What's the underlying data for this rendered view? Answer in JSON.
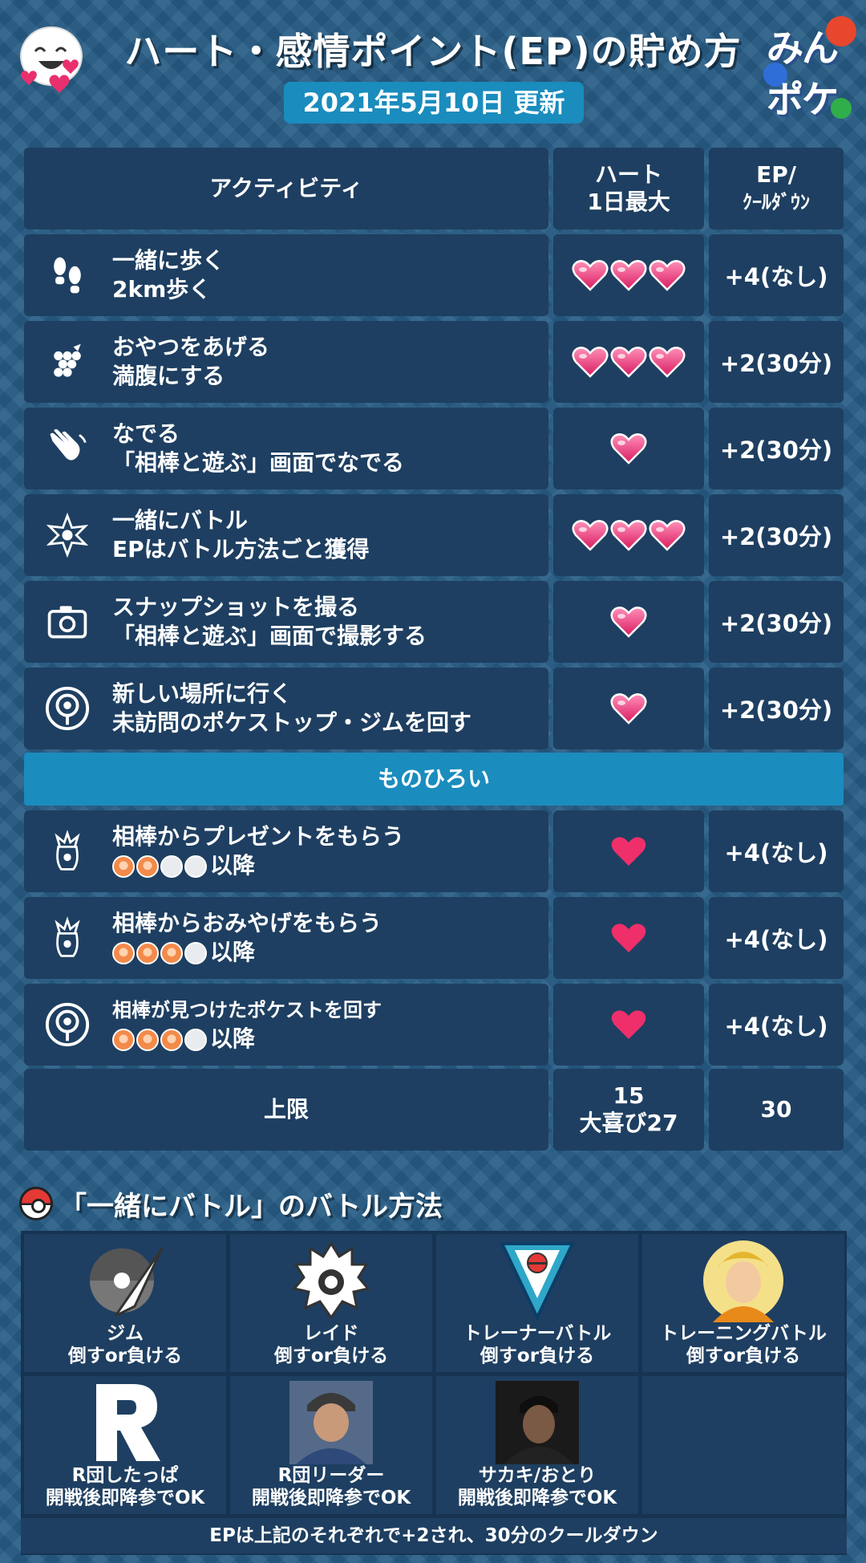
{
  "header": {
    "title": "ハート・感情ポイント(EP)の貯め方",
    "date": "2021年5月10日 更新",
    "brand_line1": "みん",
    "brand_line2": "ポケ"
  },
  "table": {
    "headers": {
      "activity": "アクティビティ",
      "hearts_l1": "ハート",
      "hearts_l2": "1日最大",
      "ep_l1": "EP/",
      "ep_l2": "ｸｰﾙﾀﾞｳﾝ"
    },
    "rows": [
      {
        "icon": "footprints-icon",
        "line1": "一緒に歩く",
        "line2": "2km歩く",
        "hearts": 3,
        "ep": "+4(なし)"
      },
      {
        "icon": "berry-icon",
        "line1": "おやつをあげる",
        "line2": "満腹にする",
        "hearts": 3,
        "ep": "+2(30分)"
      },
      {
        "icon": "hand-wave-icon",
        "line1": "なでる",
        "line2": "「相棒と遊ぶ」画面でなでる",
        "hearts": 1,
        "ep": "+2(30分)"
      },
      {
        "icon": "battle-icon",
        "line1": "一緒にバトル",
        "line2": "EPはバトル方法ごと獲得",
        "hearts": 3,
        "ep": "+2(30分)"
      },
      {
        "icon": "camera-icon",
        "line1": "スナップショットを撮る",
        "line2": "「相棒と遊ぶ」画面で撮影する",
        "hearts": 1,
        "ep": "+2(30分)"
      },
      {
        "icon": "pokestop-icon",
        "line1": "新しい場所に行く",
        "line2": "未訪問のポケストップ・ジムを回す",
        "hearts": 1,
        "ep": "+2(30分)"
      }
    ],
    "divider": "ものひろい",
    "pickup_rows": [
      {
        "icon": "present-icon",
        "line1": "相棒からプレゼントをもらう",
        "line2": "以降",
        "level": 2,
        "hearts": 1,
        "ep": "+4(なし)"
      },
      {
        "icon": "souvenir-icon",
        "line1": "相棒からおみやげをもらう",
        "line2": "以降",
        "level": 3,
        "hearts": 1,
        "ep": "+4(なし)"
      },
      {
        "icon": "pokestop-icon",
        "line1": "相棒が見つけたポケストを回す",
        "line2": "以降",
        "level": 3,
        "hearts": 1,
        "ep": "+4(なし)"
      }
    ],
    "limit": {
      "label": "上限",
      "hearts_l1": "15",
      "hearts_l2": "大喜び27",
      "ep": "30"
    }
  },
  "battle_section": {
    "title": "「一緒にバトル」のバトル方法",
    "items": [
      {
        "icon": "gym-icon",
        "name": "ジム",
        "condition": "倒すor負ける"
      },
      {
        "icon": "raid-icon",
        "name": "レイド",
        "condition": "倒すor負ける"
      },
      {
        "icon": "trainer-battle-icon",
        "name": "トレーナーバトル",
        "condition": "倒すor負ける"
      },
      {
        "icon": "team-leader-icon",
        "name": "トレーニングバトル",
        "condition": "倒すor負ける"
      },
      {
        "icon": "rocket-r-icon",
        "name": "R団したっぱ",
        "condition": "開戦後即降参でOK"
      },
      {
        "icon": "rocket-leader-icon",
        "name": "R団リーダー",
        "condition": "開戦後即降参でOK"
      },
      {
        "icon": "giovanni-icon",
        "name": "サカキ/おとり",
        "condition": "開戦後即降参でOK"
      }
    ],
    "footer": "EPは上記のそれぞれで+2され、30分のクールダウン"
  },
  "colors": {
    "background": "#275c85",
    "cell": "#1e3f61",
    "accent": "#1a8cbd",
    "heart": "#e8306e"
  }
}
